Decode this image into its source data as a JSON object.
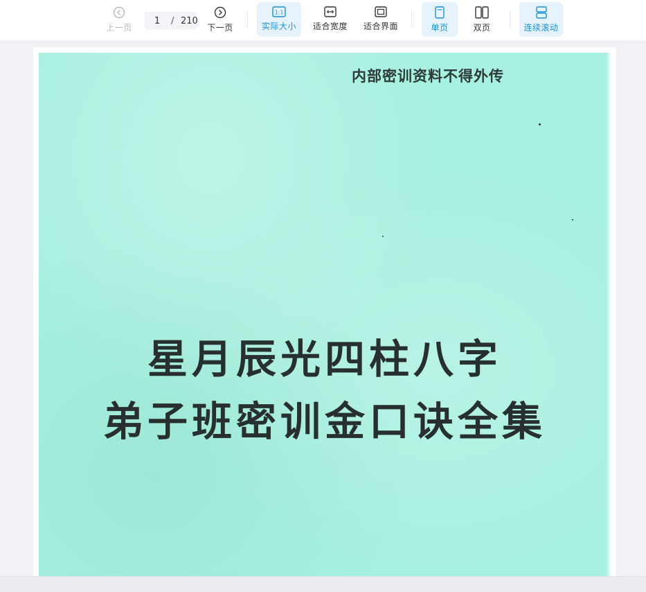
{
  "toolbar": {
    "prev_label": "上一页",
    "next_label": "下一页",
    "current_page": "1",
    "page_separator": "/",
    "total_pages": "210",
    "actual_size_label": "实际大小",
    "fit_width_label": "适合宽度",
    "fit_page_label": "适合界面",
    "single_page_label": "单页",
    "double_page_label": "双页",
    "continuous_scroll_label": "连续滚动",
    "actual_size_icon_text": "1:1",
    "active_color": "#1890d8",
    "active_bg": "#e6f3fc",
    "disabled_color": "#b5b8c0"
  },
  "document": {
    "notice": "内部密训资料不得外传",
    "title_line1": "星月辰光四柱八字",
    "title_line2": "弟子班密训金口诀全集",
    "cover_color": "#a8f0e0"
  }
}
